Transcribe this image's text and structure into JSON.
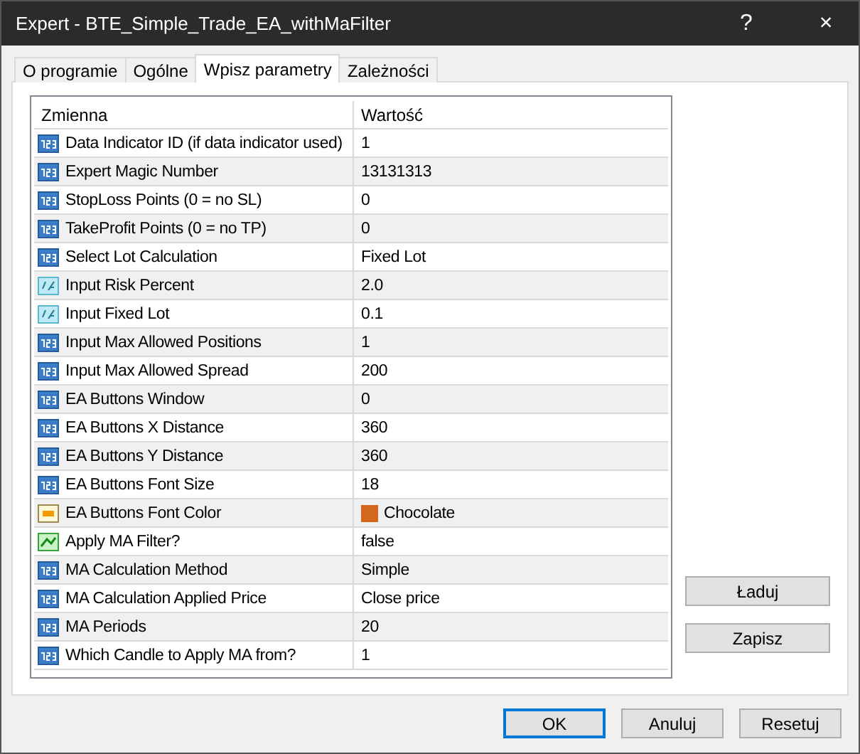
{
  "window": {
    "title": "Expert - BTE_Simple_Trade_EA_withMaFilter",
    "help": "?",
    "close": "×"
  },
  "tabs": [
    {
      "label": "O programie",
      "selected": false
    },
    {
      "label": "Ogólne",
      "selected": false
    },
    {
      "label": "Wpisz parametry",
      "selected": true
    },
    {
      "label": "Zależności",
      "selected": false
    }
  ],
  "table": {
    "columns": [
      "Zmienna",
      "Wartość"
    ],
    "rows": [
      {
        "kind": "int",
        "name": "Data Indicator ID (if data indicator used)",
        "value": "1"
      },
      {
        "kind": "int",
        "name": "Expert Magic Number",
        "value": "13131313"
      },
      {
        "kind": "int",
        "name": "StopLoss Points (0 = no SL)",
        "value": "0"
      },
      {
        "kind": "int",
        "name": "TakeProfit Points (0 = no TP)",
        "value": "0"
      },
      {
        "kind": "int",
        "name": "Select Lot Calculation",
        "value": "Fixed Lot"
      },
      {
        "kind": "double",
        "name": "Input Risk Percent",
        "value": "2.0"
      },
      {
        "kind": "double",
        "name": "Input Fixed Lot",
        "value": "0.1"
      },
      {
        "kind": "int",
        "name": "Input Max Allowed Positions",
        "value": "1"
      },
      {
        "kind": "int",
        "name": "Input Max Allowed Spread",
        "value": "200"
      },
      {
        "kind": "int",
        "name": "EA Buttons Window",
        "value": "0"
      },
      {
        "kind": "int",
        "name": "EA Buttons X Distance",
        "value": "360"
      },
      {
        "kind": "int",
        "name": "EA Buttons Y Distance",
        "value": "360"
      },
      {
        "kind": "int",
        "name": "EA Buttons Font Size",
        "value": "18"
      },
      {
        "kind": "color",
        "name": "EA Buttons Font Color",
        "value": "Chocolate",
        "color": "#d2691e"
      },
      {
        "kind": "bool",
        "name": "Apply MA Filter?",
        "value": "false"
      },
      {
        "kind": "int",
        "name": "MA Calculation Method",
        "value": "Simple"
      },
      {
        "kind": "int",
        "name": "MA Calculation Applied Price",
        "value": "Close price"
      },
      {
        "kind": "int",
        "name": "MA Periods",
        "value": "20"
      },
      {
        "kind": "int",
        "name": "Which Candle to Apply MA from?",
        "value": "1"
      }
    ]
  },
  "side_buttons": [
    "Ładuj",
    "Zapisz"
  ],
  "buttons": [
    {
      "label": "OK",
      "default": true
    },
    {
      "label": "Anuluj",
      "default": false
    },
    {
      "label": "Resetuj",
      "default": false
    }
  ]
}
